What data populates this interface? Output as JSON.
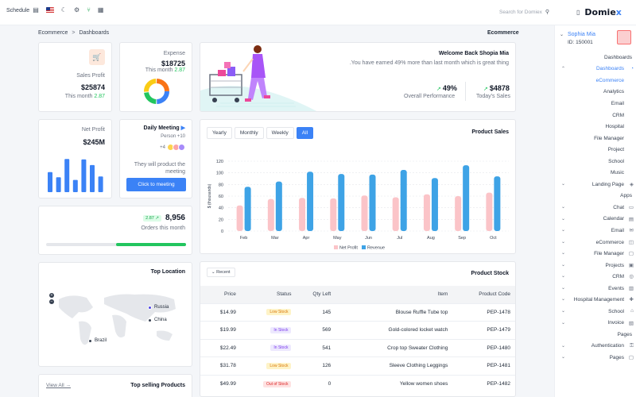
{
  "topbar": {
    "schedule_label": "Schedule",
    "search_placeholder": "Search for Domiex",
    "logo_main": "Domie",
    "logo_accent": "x"
  },
  "breadcrumb": {
    "root": "Ecommerce",
    "sep": ">",
    "current": "Dashboards",
    "right_title": "Ecommerce"
  },
  "sales_profit": {
    "label": "Sales Profit",
    "value": "$25874",
    "period": "This month",
    "change": "2.87"
  },
  "expense": {
    "label": "Expense",
    "value": "$18725",
    "period": "This month",
    "change": "2.87"
  },
  "welcome": {
    "title": "Welcome Back Shopia Mia",
    "subtitle": ".You have earned 49% more than last month which is great thing",
    "perf_value": "49%",
    "perf_label": "Overall Performance",
    "sales_value": "$4878",
    "sales_label": "Today's Sales"
  },
  "net_profit": {
    "label": "Net Profit",
    "value": "$245M",
    "bars": [
      0.46,
      0.34,
      0.76,
      0.28,
      0.75,
      0.62,
      0.36
    ]
  },
  "meeting": {
    "title": "Daily Meeting",
    "persons": "Person +10",
    "count": "+4",
    "text1": "They will product the",
    "text2": "meeting",
    "button": "Click to meeting"
  },
  "orders": {
    "change": "2.87",
    "value": "8,956",
    "label": "Orders this month",
    "progress": 0.5
  },
  "location": {
    "title": "Top Location",
    "plus": "+",
    "minus": "−",
    "markers": [
      {
        "name": "Russia",
        "color": "#4f46e5"
      },
      {
        "name": "China",
        "color": "#374151"
      },
      {
        "name": "Brazil",
        "color": "#374151"
      }
    ],
    "view_all": "View All →"
  },
  "top_selling": {
    "title": "Top selling Products"
  },
  "product_sales": {
    "title": "Product Sales",
    "tabs": [
      "Yearly",
      "Monthly",
      "Weekly",
      "All"
    ],
    "active_tab": "All"
  },
  "chart_data": {
    "type": "bar",
    "categories": [
      "Feb",
      "Mar",
      "Apr",
      "May",
      "Jun",
      "Jul",
      "Aug",
      "Sep",
      "Oct"
    ],
    "ylabel": "$ (thousands)",
    "ylim": [
      0,
      120
    ],
    "yticks": [
      0,
      20,
      40,
      60,
      80,
      100,
      120
    ],
    "series": [
      {
        "name": "Net Profit",
        "color": "#fbc4c8",
        "values": [
          44,
          55,
          57,
          56,
          61,
          58,
          63,
          60,
          66
        ]
      },
      {
        "name": "Revenue",
        "color": "#3ea3e6",
        "values": [
          76,
          85,
          102,
          98,
          97,
          105,
          91,
          113,
          94
        ]
      }
    ],
    "legend": "bottom"
  },
  "stock": {
    "title": "Product Stock",
    "recent_button": "Recent",
    "headers": [
      "Price",
      "Status",
      "Qty Left",
      "Item",
      "Product Code"
    ],
    "rows": [
      {
        "price": "$14.99",
        "status": "Low Stock",
        "kind": "low",
        "qty": "145",
        "item": "Blouse Ruffle Tube top",
        "code": "PEP-1478"
      },
      {
        "price": "$19.99",
        "status": "In Stock",
        "kind": "in",
        "qty": "569",
        "item": "Gold-colored locket watch",
        "code": "PEP-1479"
      },
      {
        "price": "$22.49",
        "status": "In Stock",
        "kind": "in",
        "qty": "541",
        "item": "Crop top Sweater Clothing",
        "code": "PEP-1480"
      },
      {
        "price": "$31.78",
        "status": "Low Stock",
        "kind": "low",
        "qty": "126",
        "item": "Sleeve Clothing Leggings",
        "code": "PEP-1481"
      },
      {
        "price": "$49.99",
        "status": "Out of Stock",
        "kind": "out",
        "qty": "0",
        "item": "Yellow women shoes",
        "code": "PEP-1482"
      }
    ]
  },
  "sidebar": {
    "user_name": "Sophia Mia",
    "user_id": "ID: 150001",
    "items": [
      {
        "label": "Dashboards",
        "type": "section"
      },
      {
        "label": "Dashboards",
        "type": "group",
        "open": true
      },
      {
        "label": "eCommerce",
        "type": "sub",
        "active": true
      },
      {
        "label": "Analytics",
        "type": "sub"
      },
      {
        "label": "Email",
        "type": "sub"
      },
      {
        "label": "CRM",
        "type": "sub"
      },
      {
        "label": "Hospital",
        "type": "sub"
      },
      {
        "label": "File Manager",
        "type": "sub"
      },
      {
        "label": "Project",
        "type": "sub"
      },
      {
        "label": "School",
        "type": "sub"
      },
      {
        "label": "Music",
        "type": "sub"
      },
      {
        "label": "Landing Page",
        "type": "group"
      },
      {
        "label": "Apps",
        "type": "section"
      },
      {
        "label": "Chat",
        "type": "group"
      },
      {
        "label": "Calendar",
        "type": "group"
      },
      {
        "label": "Email",
        "type": "group"
      },
      {
        "label": "eCommerce",
        "type": "group"
      },
      {
        "label": "File Manager",
        "type": "group"
      },
      {
        "label": "Projects",
        "type": "group"
      },
      {
        "label": "CRM",
        "type": "group"
      },
      {
        "label": "Events",
        "type": "group"
      },
      {
        "label": "Hospital Management",
        "type": "group"
      },
      {
        "label": "School",
        "type": "group"
      },
      {
        "label": "Invoice",
        "type": "group"
      },
      {
        "label": "Pages",
        "type": "section"
      },
      {
        "label": "Authentication",
        "type": "group"
      },
      {
        "label": "Pages",
        "type": "group"
      }
    ]
  }
}
